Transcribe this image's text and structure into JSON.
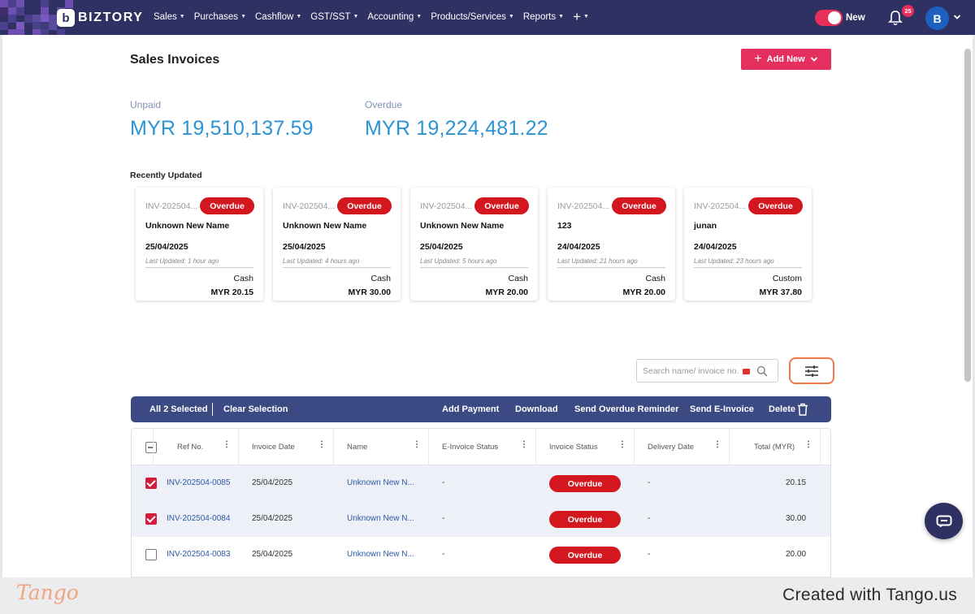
{
  "nav": {
    "brand": "BIZTORY",
    "brand_letter": "b",
    "items": [
      "Sales",
      "Purchases",
      "Cashflow",
      "GST/SST",
      "Accounting",
      "Products/Services",
      "Reports",
      "+"
    ],
    "toggle_label": "New",
    "notification_count": "25",
    "avatar_initial": "B"
  },
  "header": {
    "title": "Sales Invoices",
    "add_new_label": "Add New"
  },
  "stats": {
    "unpaid_label": "Unpaid",
    "unpaid_value": "MYR 19,510,137.59",
    "overdue_label": "Overdue",
    "overdue_value": "MYR 19,224,481.22"
  },
  "recent": {
    "title": "Recently Updated",
    "cards": [
      {
        "ref": "INV-202504...",
        "status": "Overdue",
        "name": "Unknown New Name",
        "date": "25/04/2025",
        "updated": "Last Updated: 1 hour ago",
        "method": "Cash",
        "amount": "MYR 20.15"
      },
      {
        "ref": "INV-202504...",
        "status": "Overdue",
        "name": "Unknown New Name",
        "date": "25/04/2025",
        "updated": "Last Updated: 4 hours ago",
        "method": "Cash",
        "amount": "MYR 30.00"
      },
      {
        "ref": "INV-202504...",
        "status": "Overdue",
        "name": "Unknown New Name",
        "date": "25/04/2025",
        "updated": "Last Updated: 5 hours ago",
        "method": "Cash",
        "amount": "MYR 20.00"
      },
      {
        "ref": "INV-202504...",
        "status": "Overdue",
        "name": "123",
        "date": "24/04/2025",
        "updated": "Last Updated: 21 hours ago",
        "method": "Cash",
        "amount": "MYR 20.00"
      },
      {
        "ref": "INV-202504...",
        "status": "Overdue",
        "name": "junan",
        "date": "24/04/2025",
        "updated": "Last Updated: 23 hours ago",
        "method": "Custom",
        "amount": "MYR 37.80"
      }
    ]
  },
  "search": {
    "placeholder": "Search name/ invoice no."
  },
  "actions": {
    "selected": "All 2 Selected",
    "clear": "Clear Selection",
    "add_payment": "Add Payment",
    "download": "Download",
    "send_reminder": "Send Overdue Reminder",
    "send_einvoice": "Send E-Invoice",
    "delete": "Delete"
  },
  "table": {
    "columns": [
      "Ref No.",
      "Invoice Date",
      "Name",
      "E-Invoice Status",
      "Invoice Status",
      "Delivery Date",
      "Total (MYR)"
    ],
    "rows": [
      {
        "checked": true,
        "ref": "INV-202504-0085",
        "date": "25/04/2025",
        "name": "Unknown New N...",
        "einvoice": "-",
        "status": "Overdue",
        "delivery": "-",
        "total": "20.15"
      },
      {
        "checked": true,
        "ref": "INV-202504-0084",
        "date": "25/04/2025",
        "name": "Unknown New N...",
        "einvoice": "-",
        "status": "Overdue",
        "delivery": "-",
        "total": "30.00"
      },
      {
        "checked": false,
        "ref": "INV-202504-0083",
        "date": "25/04/2025",
        "name": "Unknown New N...",
        "einvoice": "-",
        "status": "Overdue",
        "delivery": "-",
        "total": "20.00"
      }
    ]
  },
  "footer": {
    "logo": "Tango",
    "created": "Created with Tango.us"
  },
  "colors": {
    "nav_bg": "#2f3163",
    "accent": "#e3305f",
    "overdue": "#d4161e",
    "stat_blue": "#2b94d4",
    "link": "#2a5aa6",
    "highlight": "#f07a4b"
  }
}
